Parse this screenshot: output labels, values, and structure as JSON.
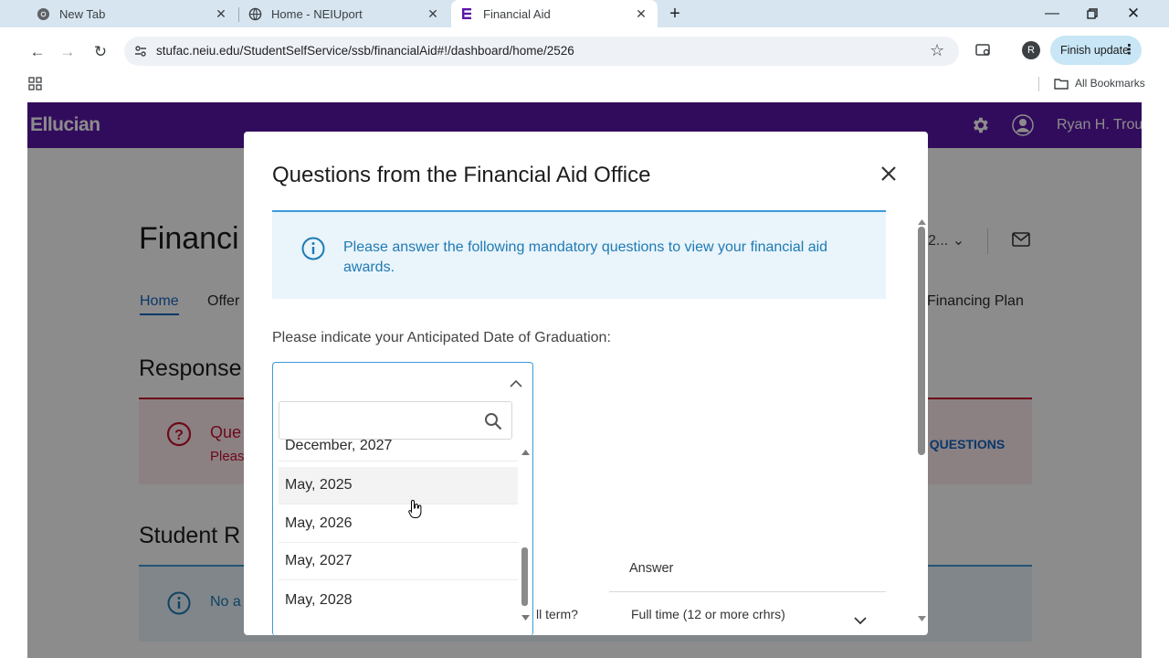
{
  "browser": {
    "tabs": [
      {
        "title": "New Tab"
      },
      {
        "title": "Home - NEIUport"
      },
      {
        "title": "Financial Aid"
      }
    ],
    "url": "stufac.neiu.edu/StudentSelfService/ssb/financialAid#!/dashboard/home/2526",
    "profile_initial": "R",
    "finish_update_label": "Finish update",
    "all_bookmarks_label": "All Bookmarks"
  },
  "app": {
    "logo": "Ellucian",
    "user_name": "Ryan H. Trou",
    "page_title": "Financi",
    "aid_year_fragment": "2...",
    "tabs": [
      {
        "label": "Home"
      },
      {
        "label": "Offer"
      },
      {
        "label": "Financing Plan"
      }
    ],
    "responses_heading": "Response",
    "questions_alert_title": "Que",
    "questions_alert_sub": "Pleas",
    "view_questions_link": "/ QUESTIONS",
    "student_req_heading": "Student R",
    "no_req_fragment": "No a"
  },
  "modal": {
    "title": "Questions from the Financial Aid Office",
    "info_message": "Please answer the following mandatory questions to view your financial aid awards.",
    "question_label": "Please indicate your Anticipated Date of Graduation:",
    "dropdown": {
      "search_placeholder": "",
      "options": [
        {
          "label": "December, 2027"
        },
        {
          "label": "May, 2025"
        },
        {
          "label": "May, 2026"
        },
        {
          "label": "May, 2027"
        },
        {
          "label": "May, 2028"
        }
      ],
      "hovered_option": "May, 2025"
    },
    "table": {
      "answer_header": "Answer",
      "row_question_fragment": "ll term?",
      "row_answer": "Full time (12 or more crhrs)"
    }
  },
  "colors": {
    "tab_bar": "#d6e5f0",
    "ellucian_purple": "#5b16a8",
    "info_blue": "#1f7ab3",
    "alert_red": "#c8102e",
    "link_blue": "#1565c0"
  }
}
